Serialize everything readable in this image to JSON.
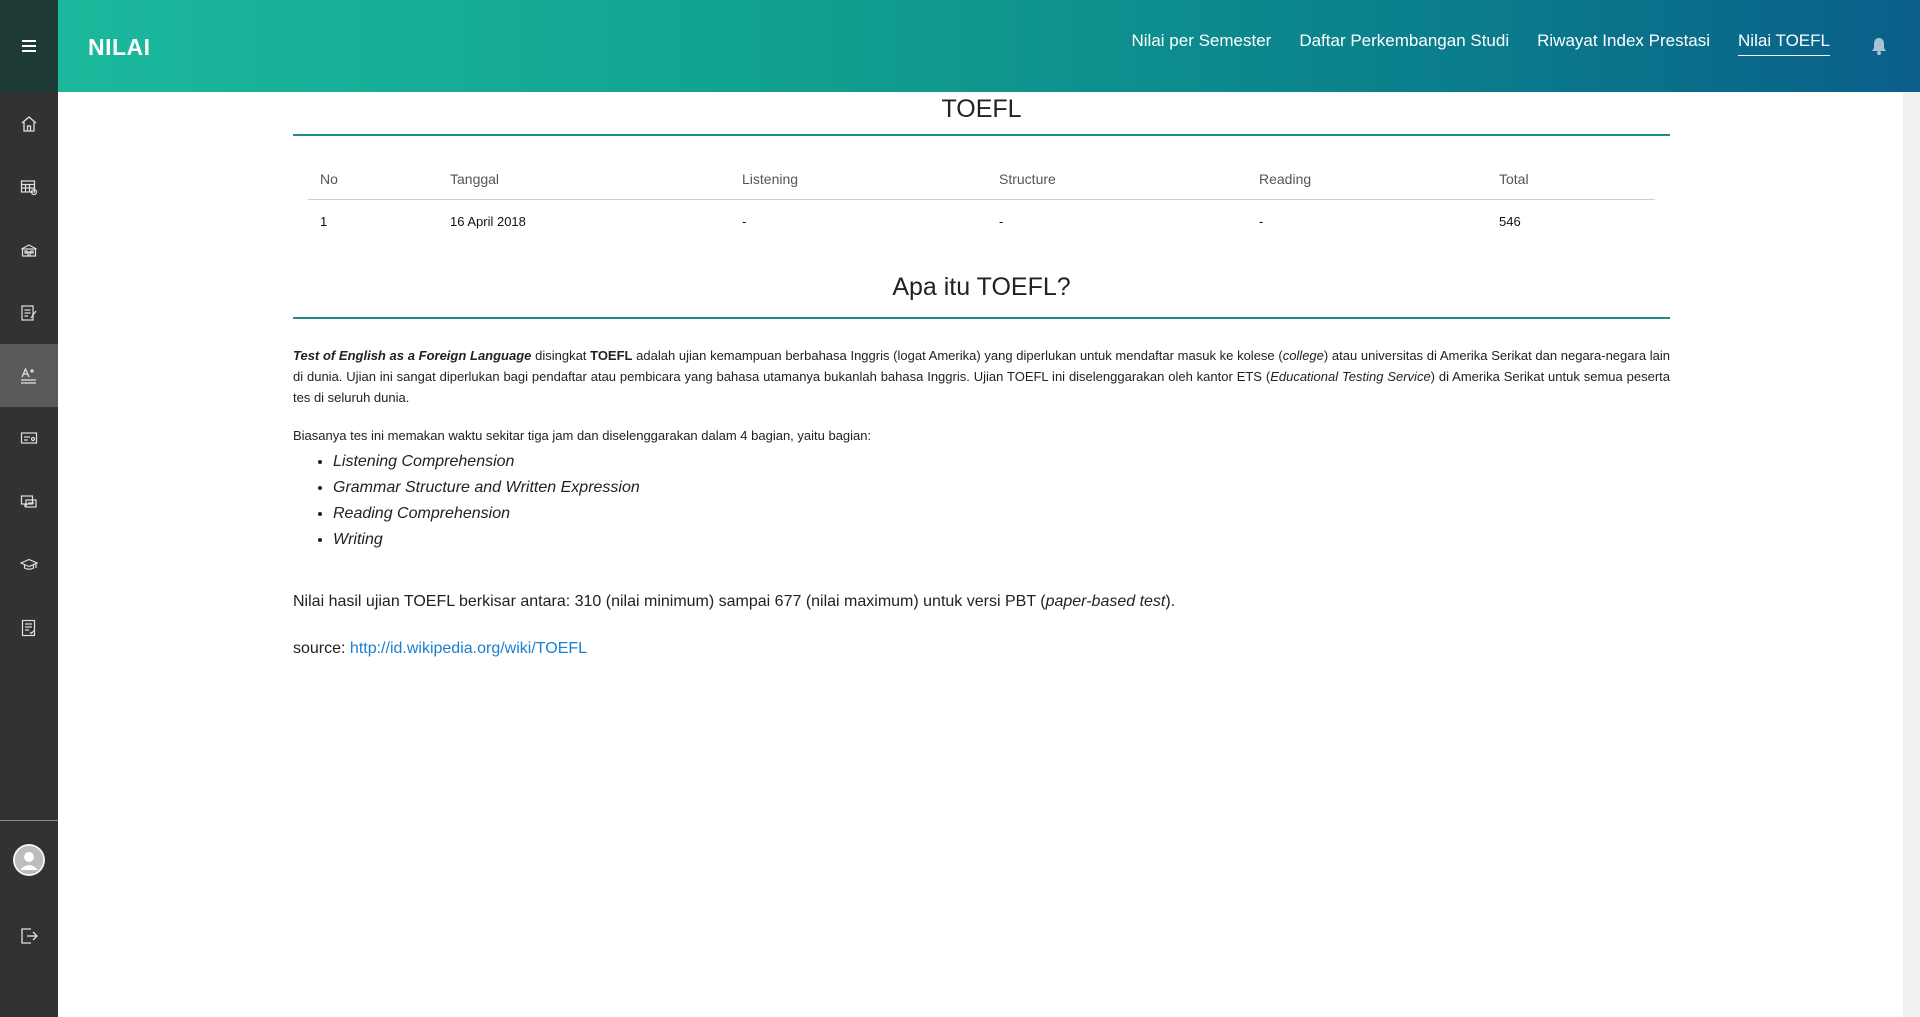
{
  "header": {
    "title": "NILAI",
    "tabs": [
      {
        "label": "Nilai per Semester"
      },
      {
        "label": "Daftar Perkembangan Studi"
      },
      {
        "label": "Riwayat Index Prestasi"
      },
      {
        "label": "Nilai TOEFL"
      }
    ],
    "active_tab": "Nilai TOEFL",
    "accent_color": "#1cb99d"
  },
  "sidebar": {
    "items": [
      {
        "icon": "home-icon"
      },
      {
        "icon": "calendar-grid-icon"
      },
      {
        "icon": "building-icon"
      },
      {
        "icon": "document-edit-icon"
      },
      {
        "icon": "grade-icon",
        "active": true
      },
      {
        "icon": "presentation-icon"
      },
      {
        "icon": "chat-icon"
      },
      {
        "icon": "graduation-cap-icon"
      },
      {
        "icon": "report-icon"
      }
    ],
    "bottom": [
      {
        "icon": "avatar-icon"
      },
      {
        "icon": "logout-icon"
      }
    ]
  },
  "toefl": {
    "title": "TOEFL",
    "columns": [
      "No",
      "Tanggal",
      "Listening",
      "Structure",
      "Reading",
      "Total"
    ],
    "rows": [
      [
        "1",
        "16 April 2018",
        "-",
        "-",
        "-",
        "546"
      ]
    ]
  },
  "info": {
    "title": "Apa itu TOEFL?",
    "p1_term": "Test of English as a Foreign Language",
    "p1_a": " disingkat ",
    "p1_abbr": "TOEFL",
    "p1_b": " adalah ujian kemampuan berbahasa Inggris (logat Amerika) yang diperlukan untuk mendaftar masuk ke kolese (",
    "p1_college": "college",
    "p1_c": ") atau universitas di Amerika Serikat dan negara-negara lain di dunia. Ujian ini sangat diperlukan bagi pendaftar atau pembicara yang bahasa utamanya bukanlah bahasa Inggris. Ujian TOEFL ini diselenggarakan oleh kantor ETS (",
    "p1_ets": "Educational Testing Service",
    "p1_d": ") di Amerika Serikat untuk semua peserta tes di seluruh dunia.",
    "p2": "Biasanya tes ini memakan waktu sekitar tiga jam dan diselenggarakan dalam 4 bagian, yaitu bagian:",
    "sections": [
      "Listening Comprehension",
      "Grammar Structure and Written Expression",
      "Reading Comprehension",
      "Writing"
    ],
    "p3_a": "Nilai hasil ujian TOEFL berkisar antara: 310 (nilai minimum) sampai 677 (nilai maximum) untuk versi PBT (",
    "p3_pbt": "paper-based test",
    "p3_b": ").",
    "source_label": "source: ",
    "source_link": "http://id.wikipedia.org/wiki/TOEFL"
  }
}
